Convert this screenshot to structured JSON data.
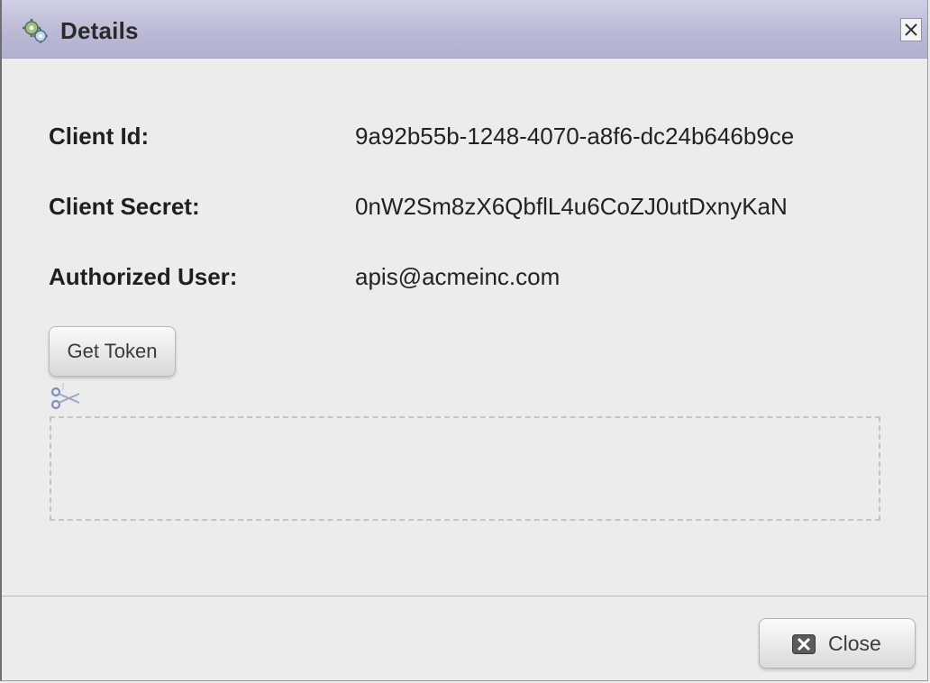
{
  "dialog": {
    "title": "Details",
    "title_icon": "gears-icon",
    "close_icon": "close-x-icon"
  },
  "fields": {
    "client_id": {
      "label": "Client Id:",
      "value": "9a92b55b-1248-4070-a8f6-dc24b646b9ce"
    },
    "client_secret": {
      "label": "Client Secret:",
      "value": "0nW2Sm8zX6QbflL4u6CoZJ0utDxnyKaN"
    },
    "authorized_user": {
      "label": "Authorized User:",
      "value": "apis@acmeinc.com"
    }
  },
  "actions": {
    "get_token_label": "Get Token",
    "close_label": "Close",
    "close_icon": "close-box-icon",
    "copy_icon": "scissors-icon"
  },
  "colors": {
    "titlebar": "#babad6",
    "background": "#ececec"
  }
}
